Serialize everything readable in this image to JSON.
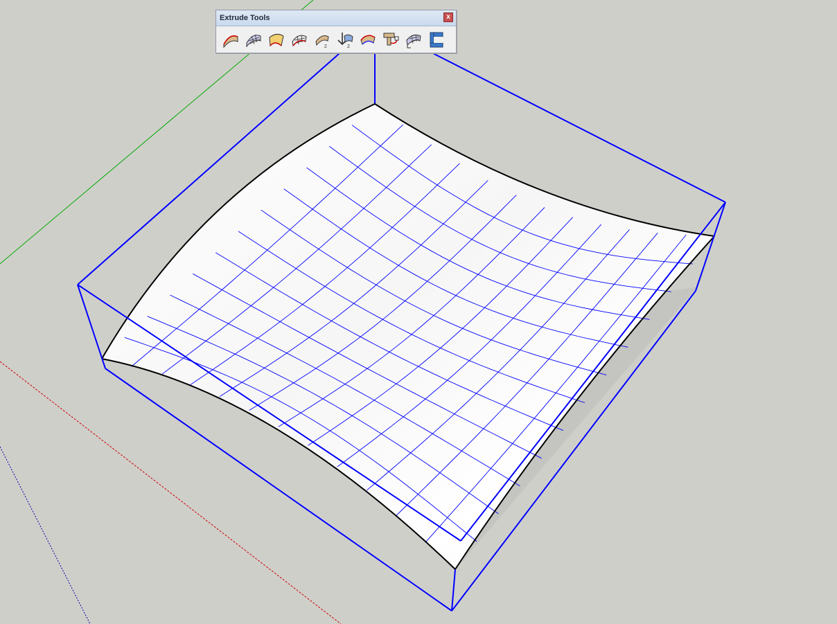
{
  "toolbar": {
    "title": "Extrude Tools",
    "close_label": "x",
    "tools": [
      {
        "icon": "extrude-edges-by-rails-icon"
      },
      {
        "icon": "extrude-edges-by-rails-lattice-icon"
      },
      {
        "icon": "extrude-edges-by-loft-icon"
      },
      {
        "icon": "extrude-edges-by-rails-to-lattice-icon"
      },
      {
        "icon": "extrude-edges-by-vector-icon"
      },
      {
        "icon": "extrude-edges-by-face-icon"
      },
      {
        "icon": "extrude-edges-by-edges-icon"
      },
      {
        "icon": "extrude-edges-by-vector-to-object-icon"
      },
      {
        "icon": "extrude-edges-by-rails-by-lattice-icon"
      },
      {
        "icon": "extrude-edges-by-tubes-icon"
      }
    ]
  },
  "scene": {
    "background_color": "#cfcfca",
    "bounding_box_color": "#0000ff",
    "wire_color": "#0000ff",
    "surface_color": "#ffffff",
    "edge_color": "#000000",
    "axis_colors": {
      "red": "#cc0000",
      "green": "#00aa00",
      "blue": "#0000aa"
    }
  }
}
